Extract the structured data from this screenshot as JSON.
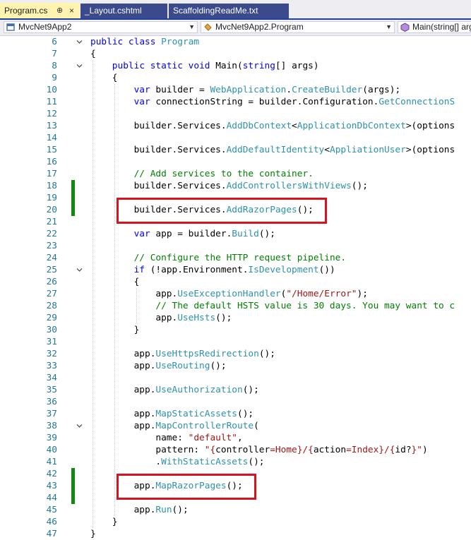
{
  "tabs": [
    {
      "label": "Program.cs",
      "active": true,
      "pin_glyph": "⊕",
      "close_glyph": "×"
    },
    {
      "label": "_Layout.cshtml",
      "active": false
    },
    {
      "label": "ScaffoldingReadMe.txt",
      "active": false
    }
  ],
  "navbar": {
    "project": "MvcNet9App2",
    "class": "MvcNet9App2.Program",
    "member": "Main(string[] args)"
  },
  "code": {
    "lines": [
      {
        "n": "6",
        "depth": 1,
        "fold": true,
        "change": false,
        "tokens": [
          {
            "t": "kw",
            "v": "public class "
          },
          {
            "t": "ty",
            "v": "Program"
          }
        ]
      },
      {
        "n": "7",
        "depth": 1,
        "fold": false,
        "change": false,
        "tokens": [
          {
            "t": "p",
            "v": "{"
          }
        ]
      },
      {
        "n": "8",
        "depth": 2,
        "fold": true,
        "change": false,
        "tokens": [
          {
            "t": "kw",
            "v": "public static void "
          },
          {
            "t": "p",
            "v": "Main("
          },
          {
            "t": "kw",
            "v": "string"
          },
          {
            "t": "p",
            "v": "[] args)"
          }
        ]
      },
      {
        "n": "9",
        "depth": 2,
        "fold": false,
        "change": false,
        "tokens": [
          {
            "t": "p",
            "v": "{"
          }
        ]
      },
      {
        "n": "10",
        "depth": 3,
        "fold": false,
        "change": false,
        "tokens": [
          {
            "t": "kw",
            "v": "var "
          },
          {
            "t": "p",
            "v": "builder = "
          },
          {
            "t": "ty",
            "v": "WebApplication"
          },
          {
            "t": "p",
            "v": "."
          },
          {
            "t": "ty",
            "v": "CreateBuilder"
          },
          {
            "t": "p",
            "v": "(args);"
          }
        ]
      },
      {
        "n": "11",
        "depth": 3,
        "fold": false,
        "change": false,
        "tokens": [
          {
            "t": "kw",
            "v": "var "
          },
          {
            "t": "p",
            "v": "connectionString = builder.Configuration."
          },
          {
            "t": "ty",
            "v": "GetConnectionS"
          }
        ]
      },
      {
        "n": "12",
        "depth": 3,
        "fold": false,
        "change": false,
        "tokens": []
      },
      {
        "n": "13",
        "depth": 3,
        "fold": false,
        "change": false,
        "tokens": [
          {
            "t": "p",
            "v": "builder.Services."
          },
          {
            "t": "ty",
            "v": "AddDbContext"
          },
          {
            "t": "p",
            "v": "<"
          },
          {
            "t": "ty",
            "v": "ApplicationDbContext"
          },
          {
            "t": "p",
            "v": ">(options"
          }
        ]
      },
      {
        "n": "14",
        "depth": 3,
        "fold": false,
        "change": false,
        "tokens": []
      },
      {
        "n": "15",
        "depth": 3,
        "fold": false,
        "change": false,
        "tokens": [
          {
            "t": "p",
            "v": "builder.Services."
          },
          {
            "t": "ty",
            "v": "AddDefaultIdentity"
          },
          {
            "t": "p",
            "v": "<"
          },
          {
            "t": "ty",
            "v": "AppliationUser"
          },
          {
            "t": "p",
            "v": ">(options"
          }
        ]
      },
      {
        "n": "16",
        "depth": 3,
        "fold": false,
        "change": false,
        "tokens": []
      },
      {
        "n": "17",
        "depth": 3,
        "fold": false,
        "change": false,
        "tokens": [
          {
            "t": "cm",
            "v": "// Add services to the container."
          }
        ]
      },
      {
        "n": "18",
        "depth": 3,
        "fold": false,
        "change": true,
        "tokens": [
          {
            "t": "p",
            "v": "builder.Services."
          },
          {
            "t": "ty",
            "v": "AddControllersWithViews"
          },
          {
            "t": "p",
            "v": "();"
          }
        ]
      },
      {
        "n": "19",
        "depth": 3,
        "fold": false,
        "change": true,
        "tokens": []
      },
      {
        "n": "20",
        "depth": 3,
        "fold": false,
        "change": true,
        "tokens": [
          {
            "t": "p",
            "v": "builder.Services."
          },
          {
            "t": "ty",
            "v": "AddRazorPages"
          },
          {
            "t": "p",
            "v": "();"
          }
        ]
      },
      {
        "n": "21",
        "depth": 3,
        "fold": false,
        "change": false,
        "tokens": []
      },
      {
        "n": "22",
        "depth": 3,
        "fold": false,
        "change": false,
        "tokens": [
          {
            "t": "kw",
            "v": "var "
          },
          {
            "t": "p",
            "v": "app = builder."
          },
          {
            "t": "ty",
            "v": "Build"
          },
          {
            "t": "p",
            "v": "();"
          }
        ]
      },
      {
        "n": "23",
        "depth": 3,
        "fold": false,
        "change": false,
        "tokens": []
      },
      {
        "n": "24",
        "depth": 3,
        "fold": false,
        "change": false,
        "tokens": [
          {
            "t": "cm",
            "v": "// Configure the HTTP request pipeline."
          }
        ]
      },
      {
        "n": "25",
        "depth": 3,
        "fold": true,
        "change": false,
        "tokens": [
          {
            "t": "kw",
            "v": "if "
          },
          {
            "t": "p",
            "v": "(!app.Environment."
          },
          {
            "t": "ty",
            "v": "IsDevelopment"
          },
          {
            "t": "p",
            "v": "())"
          }
        ]
      },
      {
        "n": "26",
        "depth": 3,
        "fold": false,
        "change": false,
        "tokens": [
          {
            "t": "p",
            "v": "{"
          }
        ]
      },
      {
        "n": "27",
        "depth": 4,
        "fold": false,
        "change": false,
        "tokens": [
          {
            "t": "p",
            "v": "app."
          },
          {
            "t": "ty",
            "v": "UseExceptionHandler"
          },
          {
            "t": "p",
            "v": "("
          },
          {
            "t": "st",
            "v": "\"/Home/Error\""
          },
          {
            "t": "p",
            "v": ");"
          }
        ]
      },
      {
        "n": "28",
        "depth": 4,
        "fold": false,
        "change": false,
        "tokens": [
          {
            "t": "cm",
            "v": "// The default HSTS value is 30 days. You may want to c"
          }
        ]
      },
      {
        "n": "29",
        "depth": 4,
        "fold": false,
        "change": false,
        "tokens": [
          {
            "t": "p",
            "v": "app."
          },
          {
            "t": "ty",
            "v": "UseHsts"
          },
          {
            "t": "p",
            "v": "();"
          }
        ]
      },
      {
        "n": "30",
        "depth": 3,
        "fold": false,
        "change": false,
        "tokens": [
          {
            "t": "p",
            "v": "}"
          }
        ]
      },
      {
        "n": "31",
        "depth": 3,
        "fold": false,
        "change": false,
        "tokens": []
      },
      {
        "n": "32",
        "depth": 3,
        "fold": false,
        "change": false,
        "tokens": [
          {
            "t": "p",
            "v": "app."
          },
          {
            "t": "ty",
            "v": "UseHttpsRedirection"
          },
          {
            "t": "p",
            "v": "();"
          }
        ]
      },
      {
        "n": "33",
        "depth": 3,
        "fold": false,
        "change": false,
        "tokens": [
          {
            "t": "p",
            "v": "app."
          },
          {
            "t": "ty",
            "v": "UseRouting"
          },
          {
            "t": "p",
            "v": "();"
          }
        ]
      },
      {
        "n": "34",
        "depth": 3,
        "fold": false,
        "change": false,
        "tokens": []
      },
      {
        "n": "35",
        "depth": 3,
        "fold": false,
        "change": false,
        "tokens": [
          {
            "t": "p",
            "v": "app."
          },
          {
            "t": "ty",
            "v": "UseAuthorization"
          },
          {
            "t": "p",
            "v": "();"
          }
        ]
      },
      {
        "n": "36",
        "depth": 3,
        "fold": false,
        "change": false,
        "tokens": []
      },
      {
        "n": "37",
        "depth": 3,
        "fold": false,
        "change": false,
        "tokens": [
          {
            "t": "p",
            "v": "app."
          },
          {
            "t": "ty",
            "v": "MapStaticAssets"
          },
          {
            "t": "p",
            "v": "();"
          }
        ]
      },
      {
        "n": "38",
        "depth": 3,
        "fold": true,
        "change": false,
        "tokens": [
          {
            "t": "p",
            "v": "app."
          },
          {
            "t": "ty",
            "v": "MapControllerRoute"
          },
          {
            "t": "p",
            "v": "("
          }
        ]
      },
      {
        "n": "39",
        "depth": 4,
        "fold": false,
        "change": false,
        "tokens": [
          {
            "t": "p",
            "v": "name: "
          },
          {
            "t": "st",
            "v": "\"default\""
          },
          {
            "t": "p",
            "v": ","
          }
        ]
      },
      {
        "n": "40",
        "depth": 4,
        "fold": false,
        "change": false,
        "tokens": [
          {
            "t": "p",
            "v": "pattern: "
          },
          {
            "t": "st",
            "v": "\"{"
          },
          {
            "t": "p",
            "v": "controller"
          },
          {
            "t": "st",
            "v": "=Home}/{"
          },
          {
            "t": "p",
            "v": "action"
          },
          {
            "t": "st",
            "v": "=Index}/{"
          },
          {
            "t": "p",
            "v": "id?"
          },
          {
            "t": "st",
            "v": "}\""
          },
          {
            "t": "p",
            "v": ")"
          }
        ]
      },
      {
        "n": "41",
        "depth": 4,
        "fold": false,
        "change": false,
        "tokens": [
          {
            "t": "p",
            "v": "."
          },
          {
            "t": "ty",
            "v": "WithStaticAssets"
          },
          {
            "t": "p",
            "v": "();"
          }
        ]
      },
      {
        "n": "42",
        "depth": 3,
        "fold": false,
        "change": true,
        "tokens": []
      },
      {
        "n": "43",
        "depth": 3,
        "fold": false,
        "change": true,
        "tokens": [
          {
            "t": "p",
            "v": "app."
          },
          {
            "t": "ty",
            "v": "MapRazorPages"
          },
          {
            "t": "p",
            "v": "();"
          }
        ]
      },
      {
        "n": "44",
        "depth": 3,
        "fold": false,
        "change": true,
        "tokens": []
      },
      {
        "n": "45",
        "depth": 3,
        "fold": false,
        "change": false,
        "tokens": [
          {
            "t": "p",
            "v": "app."
          },
          {
            "t": "ty",
            "v": "Run"
          },
          {
            "t": "p",
            "v": "();"
          }
        ]
      },
      {
        "n": "46",
        "depth": 2,
        "fold": false,
        "change": false,
        "tokens": [
          {
            "t": "p",
            "v": "}"
          }
        ]
      },
      {
        "n": "47",
        "depth": 1,
        "fold": false,
        "change": false,
        "tokens": [
          {
            "t": "p",
            "v": "}"
          }
        ]
      }
    ]
  },
  "highlights": [
    {
      "line": "20"
    },
    {
      "line": "43"
    }
  ],
  "colors": {
    "keyword": "#0000ff",
    "type": "#2b91af",
    "string": "#a31515",
    "comment": "#008000",
    "line_number": "#237893",
    "change_bar": "#108a10",
    "highlight": "#d9121f",
    "active_tab": "#fff3b0",
    "inactive_tab": "#3a4a8c"
  }
}
